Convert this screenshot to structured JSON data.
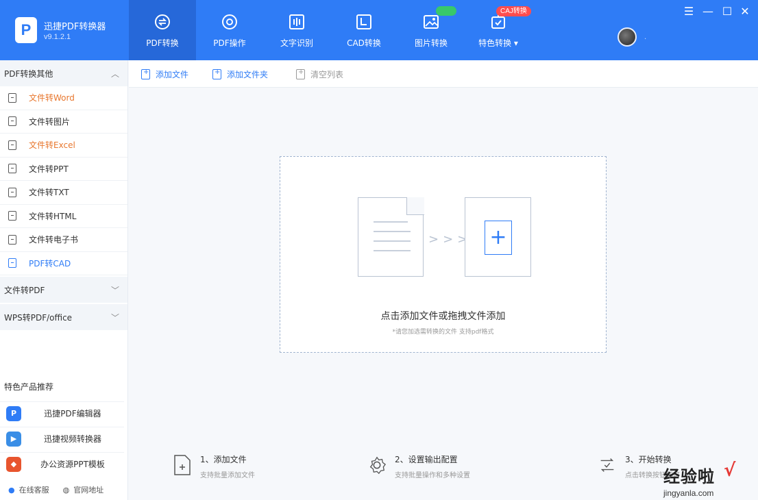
{
  "app": {
    "name": "迅捷PDF转换器",
    "version": "v9.1.2.1"
  },
  "nav": [
    {
      "label": "PDF转换",
      "icon": "convert-icon",
      "active": true
    },
    {
      "label": "PDF操作",
      "icon": "pdf-operate-icon"
    },
    {
      "label": "文字识别",
      "icon": "text-ocr-icon"
    },
    {
      "label": "CAD转换",
      "icon": "cad-icon"
    },
    {
      "label": "图片转换",
      "icon": "image-icon"
    },
    {
      "label": "特色转换",
      "icon": "special-icon",
      "badge": "CAJ转换"
    }
  ],
  "window": {
    "menu": "☰",
    "minimize": "—",
    "maximize": "☐",
    "close": "✕"
  },
  "sidebar": {
    "section1": {
      "title": "PDF转换其他"
    },
    "items": [
      {
        "label": "文件转Word",
        "color": "orange"
      },
      {
        "label": "文件转图片"
      },
      {
        "label": "文件转Excel",
        "color": "orange"
      },
      {
        "label": "文件转PPT"
      },
      {
        "label": "文件转TXT"
      },
      {
        "label": "文件转HTML"
      },
      {
        "label": "文件转电子书"
      },
      {
        "label": "PDF转CAD",
        "color": "blue",
        "active": true
      }
    ],
    "section2": {
      "title": "文件转PDF"
    },
    "section3": {
      "title": "WPS转PDF/office"
    },
    "products_title": "特色产品推荐",
    "products": [
      {
        "label": "迅捷PDF编辑器",
        "color": "#2f7cf6"
      },
      {
        "label": "迅捷视频转换器",
        "color": "#3a8ee6"
      },
      {
        "label": "办公资源PPT模板",
        "color": "#e8552e"
      }
    ],
    "bottom": {
      "service": "在线客服",
      "website": "官网地址"
    }
  },
  "toolbar": {
    "add_file": "添加文件",
    "add_folder": "添加文件夹",
    "clear_list": "清空列表"
  },
  "dropzone": {
    "title": "点击添加文件或拖拽文件添加",
    "subtitle": "*请您加选需转换的文件  支持pdf格式"
  },
  "steps": [
    {
      "title": "1、添加文件",
      "desc": "支持批量添加文件"
    },
    {
      "title": "2、设置输出配置",
      "desc": "支持批量操作和多种设置"
    },
    {
      "title": "3、开始转换",
      "desc": "点击转换按钮即可"
    }
  ],
  "watermark": {
    "main": "经验啦",
    "url": "jingyanla.com",
    "check": "√"
  }
}
